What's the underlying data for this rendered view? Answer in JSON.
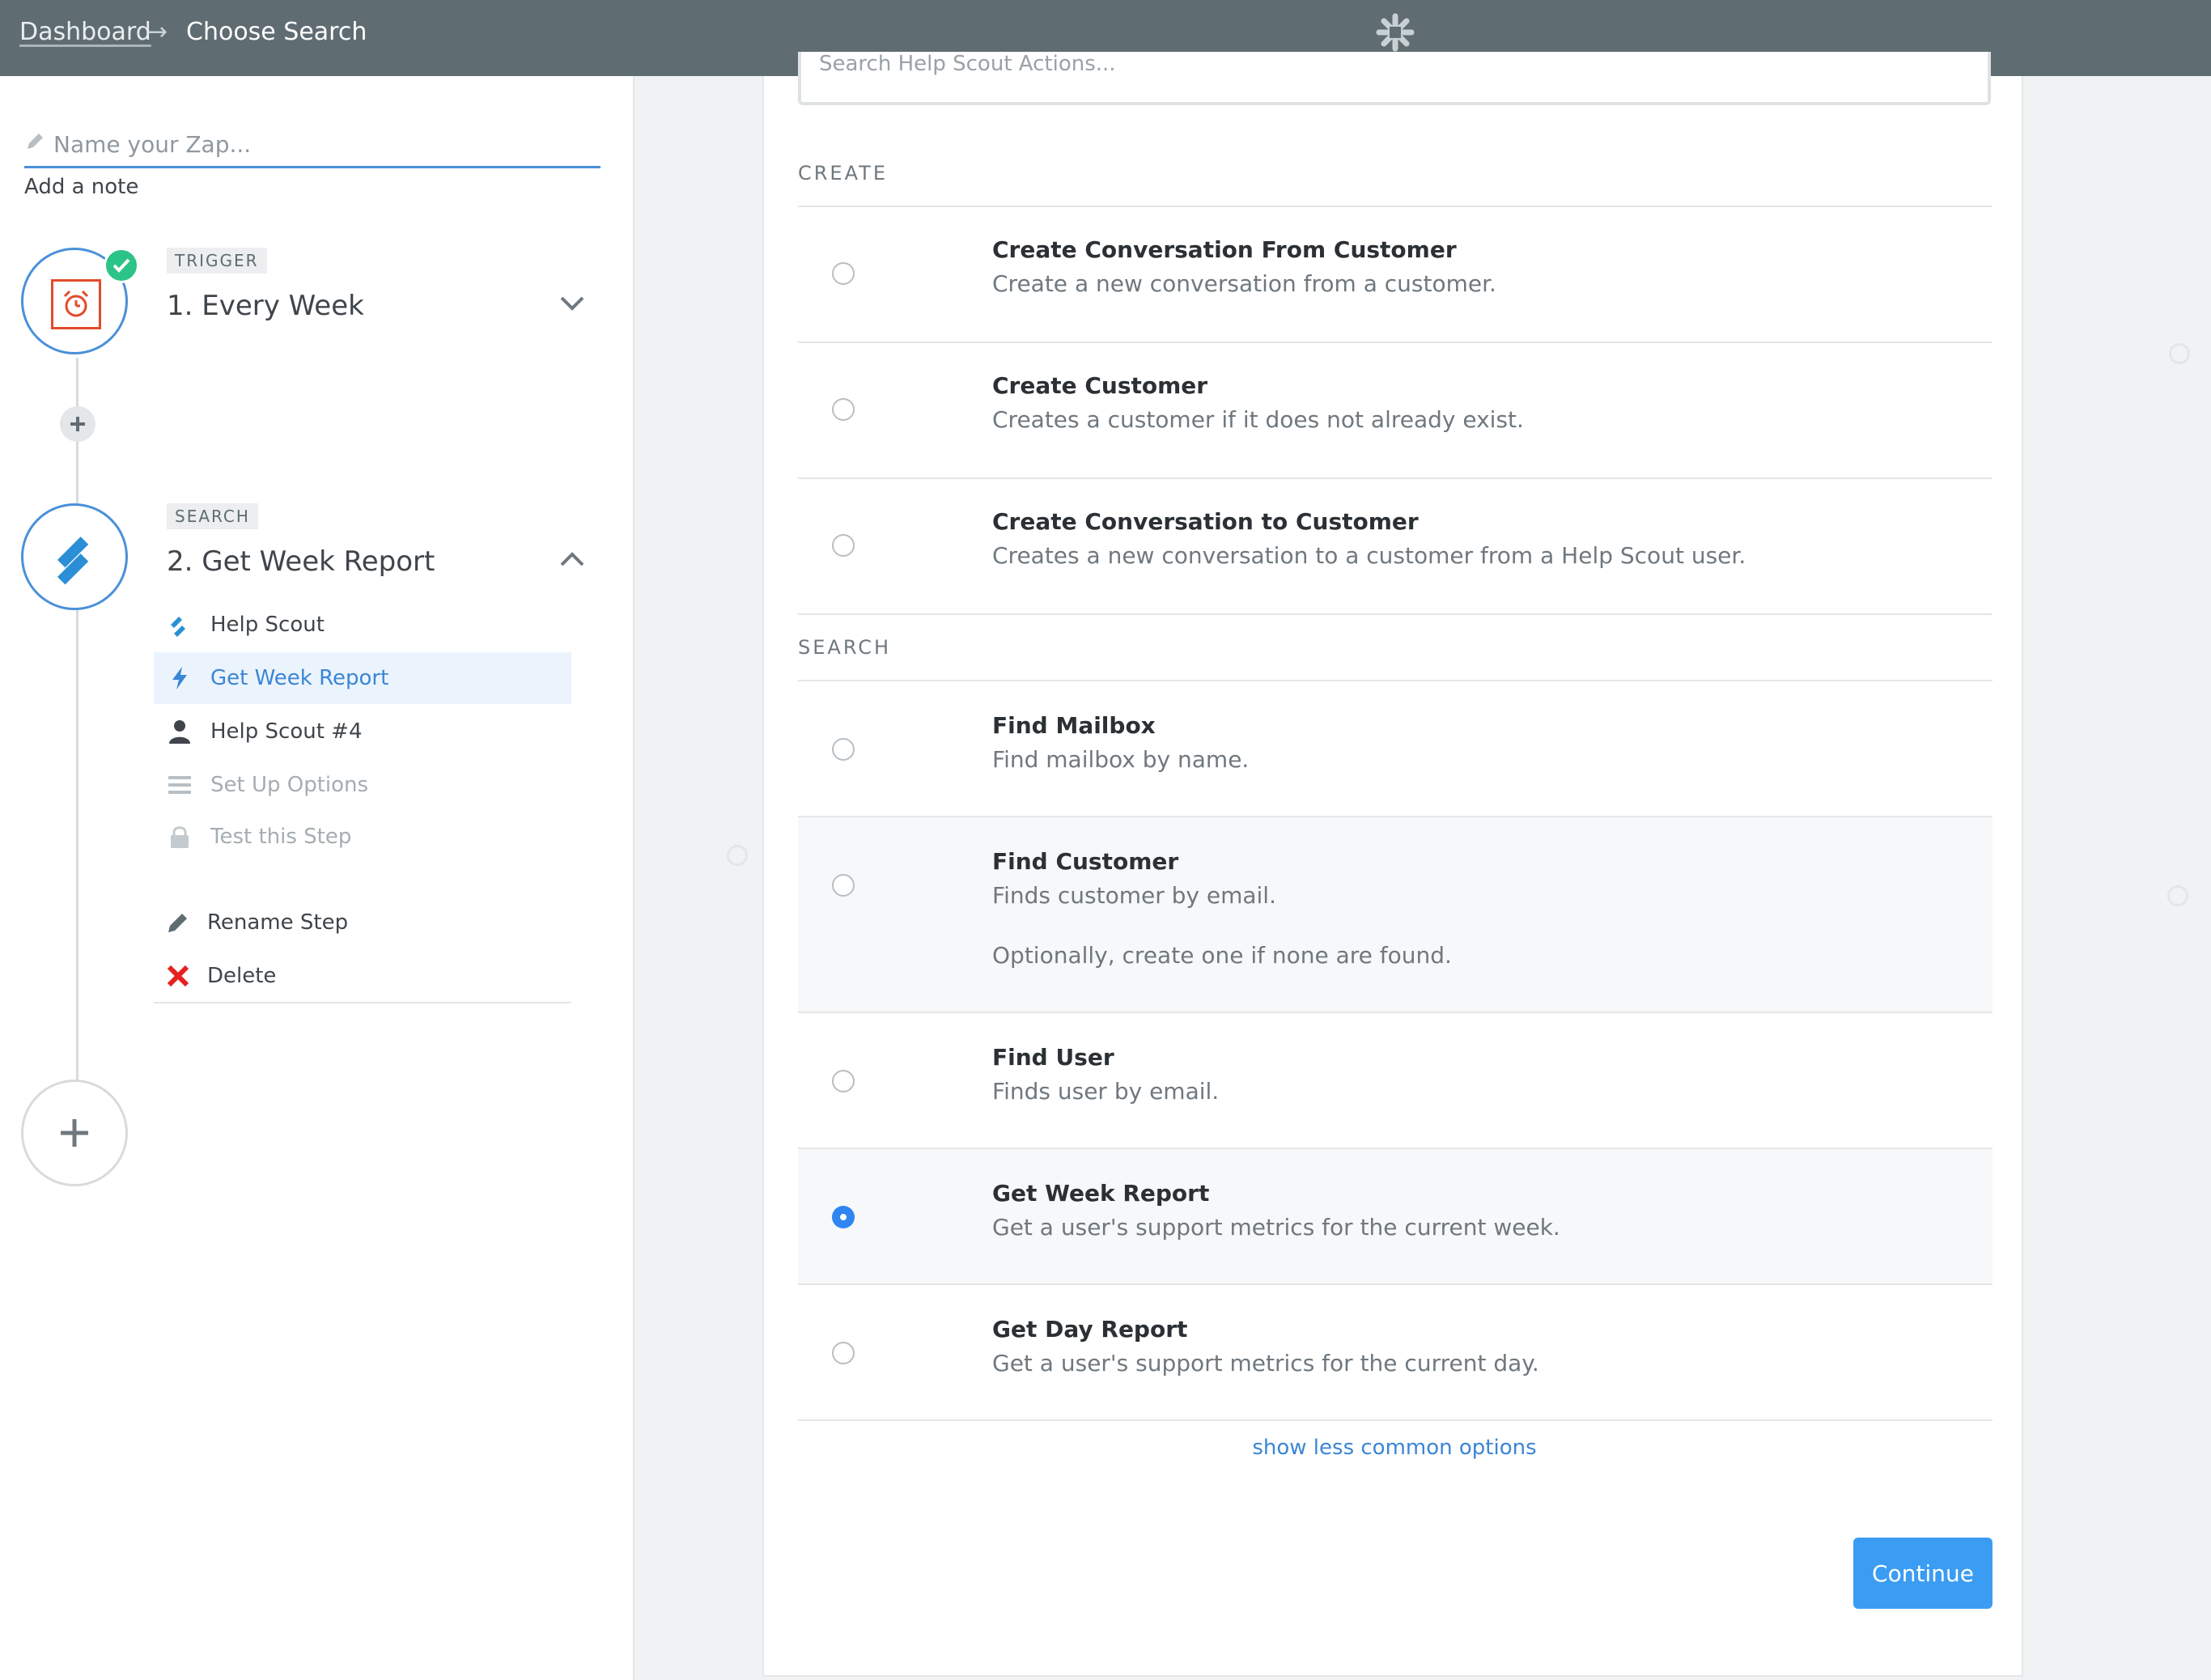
{
  "breadcrumb": {
    "root": "Dashboard",
    "arrow": "→",
    "current": "Choose Search"
  },
  "sidebar": {
    "zap_name_placeholder": "Name your Zap...",
    "add_note": "Add a note",
    "steps": [
      {
        "tag": "TRIGGER",
        "title": "1. Every Week",
        "status": "complete",
        "icon": "alarm-clock-icon"
      },
      {
        "tag": "SEARCH",
        "title": "2. Get Week Report",
        "icon": "help-scout-icon",
        "sub_items": [
          {
            "label": "Help Scout",
            "icon": "help-scout-icon",
            "state": "default"
          },
          {
            "label": "Get Week Report",
            "icon": "lightning-icon",
            "state": "active"
          },
          {
            "label": "Help Scout #4",
            "icon": "user-icon",
            "state": "default"
          },
          {
            "label": "Set Up Options",
            "icon": "list-icon",
            "state": "muted"
          },
          {
            "label": "Test this Step",
            "icon": "lock-icon",
            "state": "muted"
          }
        ],
        "actions": [
          {
            "label": "Rename Step",
            "icon": "pencil-icon"
          },
          {
            "label": "Delete",
            "icon": "delete-x-icon"
          }
        ]
      }
    ]
  },
  "main": {
    "search_placeholder": "Search Help Scout Actions...",
    "sections": [
      {
        "label": "CREATE",
        "options": [
          {
            "title": "Create Conversation From Customer",
            "desc": "Create a new conversation from a customer.",
            "selected": false
          },
          {
            "title": "Create Customer",
            "desc": "Creates a customer if it does not already exist.",
            "selected": false
          },
          {
            "title": "Create Conversation to Customer",
            "desc": "Creates a new conversation to a customer from a Help Scout user.",
            "selected": false
          }
        ]
      },
      {
        "label": "SEARCH",
        "options": [
          {
            "title": "Find Mailbox",
            "desc": "Find mailbox by name.",
            "selected": false
          },
          {
            "title": "Find Customer",
            "desc": "Finds customer by email.",
            "desc2": "Optionally, create one if none are found.",
            "selected": false
          },
          {
            "title": "Find User",
            "desc": "Finds user by email.",
            "selected": false
          },
          {
            "title": "Get Week Report",
            "desc": "Get a user's support metrics for the current week.",
            "selected": true
          },
          {
            "title": "Get Day Report",
            "desc": "Get a user's support metrics for the current day.",
            "selected": false
          }
        ]
      }
    ],
    "show_less": "show less common options",
    "continue": "Continue"
  },
  "colors": {
    "topbar": "#5f6c72",
    "accent": "#3b9cf3",
    "success": "#2cc486",
    "danger": "#e62020",
    "trigger_icon": "#e24c2a"
  }
}
